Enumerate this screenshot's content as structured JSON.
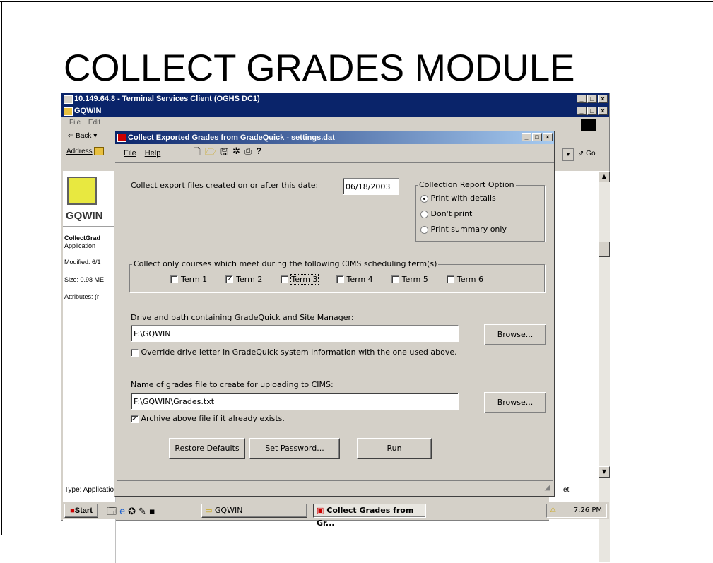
{
  "slide": {
    "title": "COLLECT GRADES MODULE"
  },
  "terminal": {
    "title": "10.149.64.8 - Terminal Services Client (OGHS DC1)",
    "inner_title": "GQWIN"
  },
  "explorer": {
    "menu": [
      "File",
      "Edit"
    ],
    "back_label": "Back",
    "address_label": "Address",
    "go_label": "Go",
    "folder_name": "GQWIN",
    "file_name": "CollectGrad",
    "file_type": "Application",
    "modified": "Modified: 6/1",
    "size": "Size: 0.98 ME",
    "attributes": "Attributes: (r",
    "status": "Type: Applicatio",
    "status_right": "et"
  },
  "taskbar": {
    "start": "Start",
    "task1": "GQWIN",
    "task2": "Collect Grades from Gr...",
    "clock": "7:26 PM"
  },
  "dialog": {
    "title": "Collect Exported Grades from GradeQuick - settings.dat",
    "menu": {
      "file": "File",
      "help": "Help"
    },
    "date_label": "Collect export files created on or after this date:",
    "date_value": "06/18/2003",
    "report_group": "Collection Report Option",
    "report_options": [
      "Print with details",
      "Don't print",
      "Print summary only"
    ],
    "report_selected": 0,
    "terms_group": "Collect only courses which meet during the following CIMS scheduling term(s)",
    "terms": [
      {
        "label": "Term 1",
        "checked": false
      },
      {
        "label": "Term 2",
        "checked": true
      },
      {
        "label": "Term 3",
        "checked": false
      },
      {
        "label": "Term 4",
        "checked": false
      },
      {
        "label": "Term 5",
        "checked": false
      },
      {
        "label": "Term 6",
        "checked": false
      }
    ],
    "path_label": "Drive and path containing GradeQuick and Site Manager:",
    "path_value": "F:\\GQWIN",
    "browse_label": "Browse...",
    "override_label": "Override drive letter in GradeQuick system information with the one used above.",
    "override_checked": false,
    "grades_label": "Name of grades file to create for uploading to CIMS:",
    "grades_value": "F:\\GQWIN\\Grades.txt",
    "archive_label": "Archive above file if it already exists.",
    "archive_checked": true,
    "buttons": {
      "restore": "Restore Defaults",
      "password": "Set Password...",
      "run": "Run"
    }
  }
}
